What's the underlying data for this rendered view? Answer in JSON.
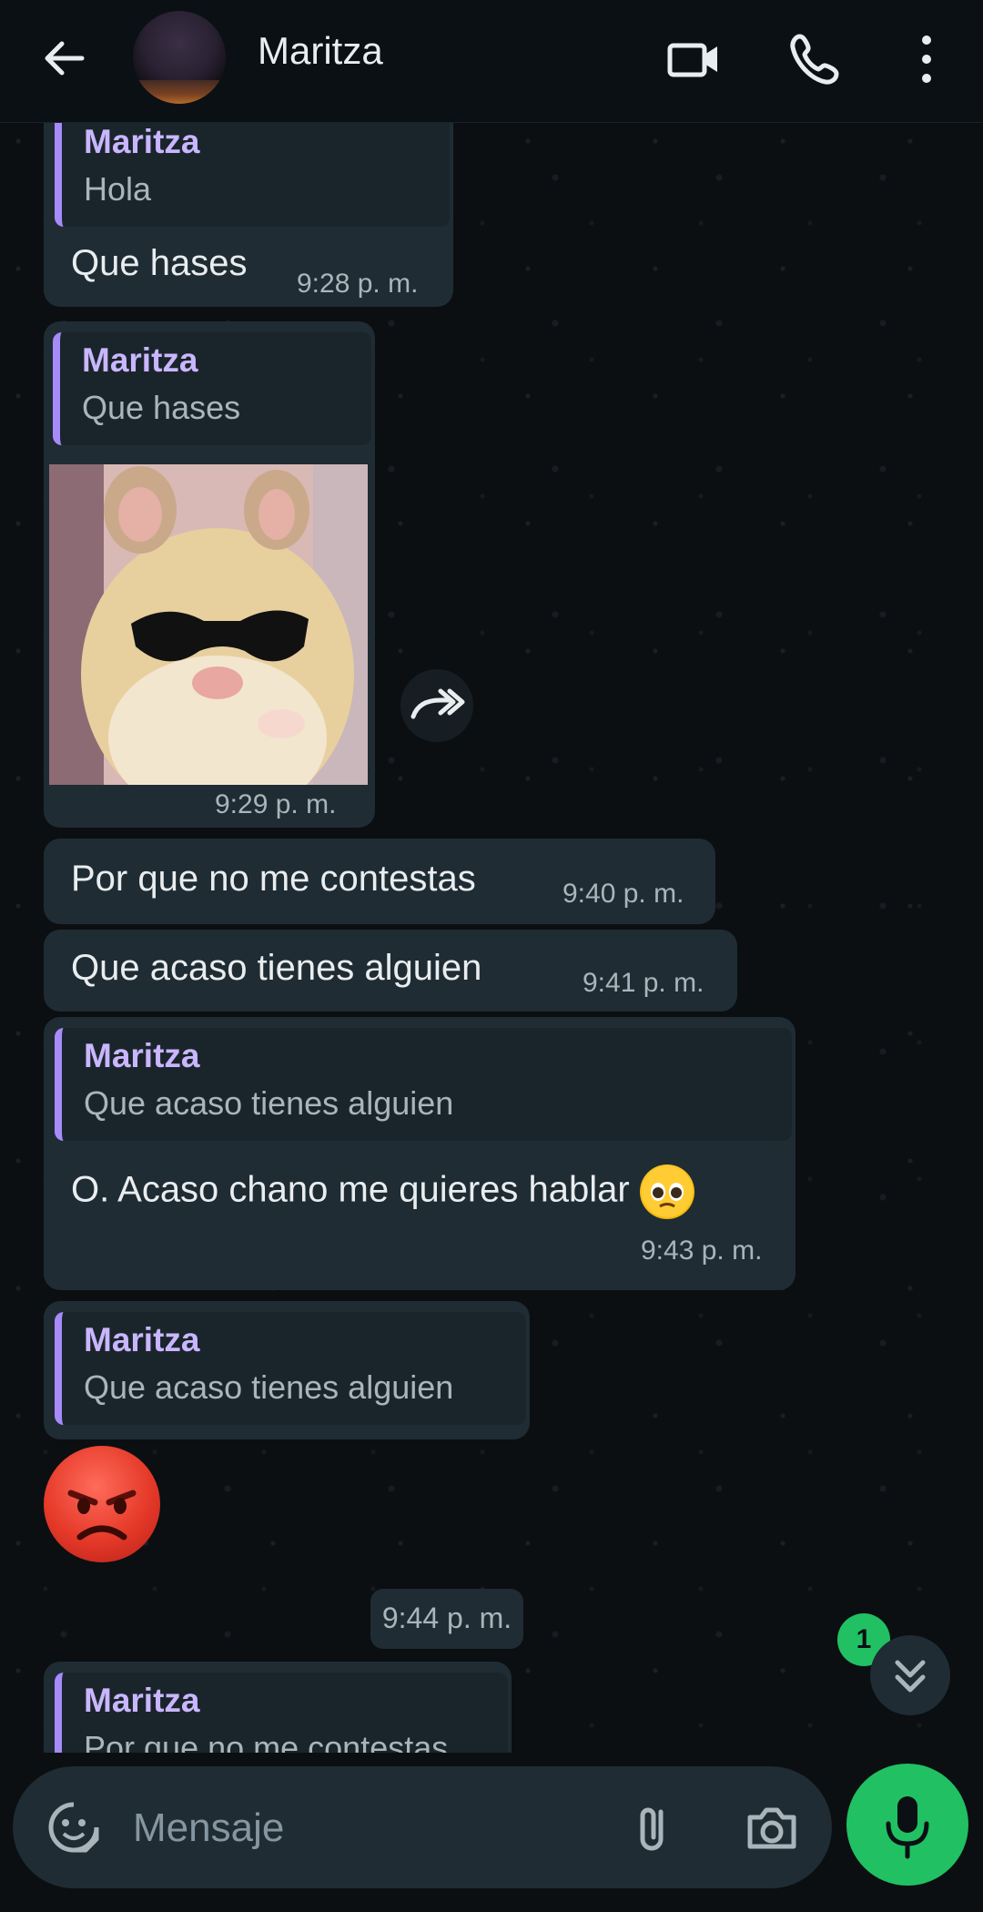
{
  "header": {
    "contact_name": "Maritza",
    "icons": [
      "back-arrow-icon",
      "video-call-icon",
      "phone-call-icon",
      "more-options-icon"
    ]
  },
  "messages": [
    {
      "quote_name": "Maritza",
      "quote_text": "Hola",
      "text": "Que hases",
      "time": "9:28 p. m."
    },
    {
      "quote_name": "Maritza",
      "quote_text": "Que hases",
      "media": "hamster-sunglasses-image",
      "time": "9:29 p. m."
    },
    {
      "text": "Por que no me contestas",
      "time": "9:40 p. m."
    },
    {
      "text": "Que acaso  tienes  alguien",
      "time": "9:41 p. m."
    },
    {
      "quote_name": "Maritza",
      "quote_text": "Que acaso  tienes  alguien",
      "text": "O. Acaso chano me quieres  hablar",
      "emoji": "pleading-face-emoji",
      "time": "9:43 p. m."
    },
    {
      "quote_name": "Maritza",
      "quote_text": "Que acaso  tienes  alguien",
      "emoji": "angry-face-emoji"
    },
    {
      "quote_name": "Maritza",
      "quote_text": "Por que no me contestas"
    }
  ],
  "day_pill_time": "9:44 p. m.",
  "unread_badge": "1",
  "composer": {
    "placeholder": "Mensaje"
  },
  "colors": {
    "accent_green": "#21c063",
    "quote_bar": "#a78bfa",
    "quote_name": "#c9b6ff",
    "bubble": "#1f2c33",
    "background": "#0b0f12"
  }
}
